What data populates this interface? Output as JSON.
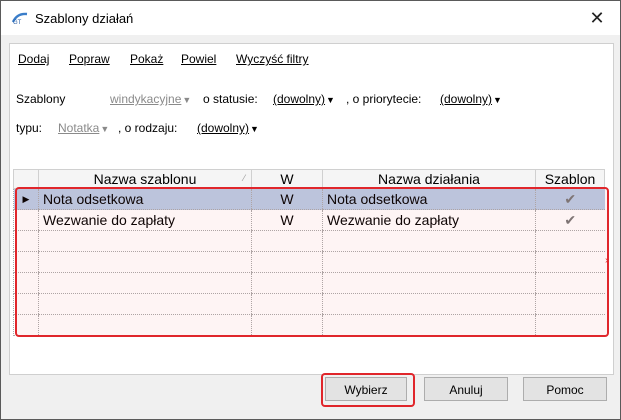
{
  "window": {
    "title": "Szablony działań",
    "close_glyph": "✕"
  },
  "menu": [
    "Dodaj",
    "Popraw",
    "Pokaż",
    "Powiel",
    "Wyczyść filtry"
  ],
  "filters": {
    "szablony_label": "Szablony",
    "szablony_value": "windykacyjne",
    "status_label": "o statusie:",
    "status_value": "(dowolny)",
    "priorytet_label": ", o priorytecie:",
    "priorytet_value": "(dowolny)",
    "typ_label": "typu:",
    "typ_value": "Notatka",
    "rodzaj_label": ", o rodzaju:",
    "rodzaj_value": "(dowolny)"
  },
  "grid": {
    "columns": [
      "Nazwa szablonu",
      "W",
      "Nazwa działania",
      "Szablon"
    ],
    "rows": [
      {
        "nazwa": "Nota odsetkowa",
        "w": "W",
        "dzialanie": "Nota odsetkowa",
        "szablon": "✔",
        "selected": true
      },
      {
        "nazwa": "Wezwanie do zapłaty",
        "w": "W",
        "dzialanie": "Wezwanie do zapłaty",
        "szablon": "✔",
        "selected": false
      }
    ],
    "empty_rows": 5
  },
  "buttons": {
    "wybierz": "Wybierz",
    "anuluj": "Anuluj",
    "pomoc": "Pomoc"
  },
  "colors": {
    "highlight": "#e0262b",
    "selection": "#b9cde6"
  }
}
